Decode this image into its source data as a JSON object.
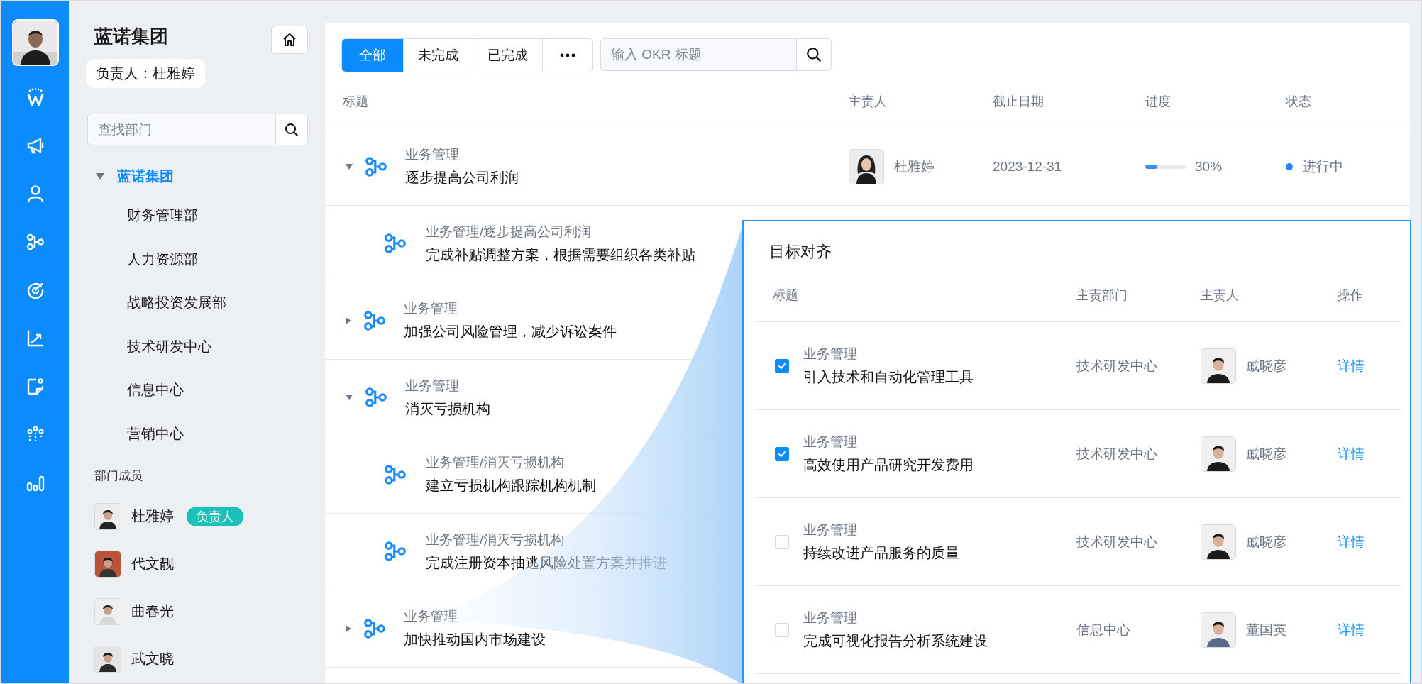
{
  "org": {
    "title": "蓝诺集团",
    "owner": "负责人：杜雅婷",
    "search": {
      "placeholder": "查找部门"
    },
    "tree": [
      {
        "label": "蓝诺集团",
        "selected": true,
        "expanded": true,
        "children": [
          {
            "label": "财务管理部",
            "selected": false
          },
          {
            "label": "人力资源部",
            "selected": false
          },
          {
            "label": "战略投资发展部",
            "selected": false
          },
          {
            "label": "技术研发中心",
            "selected": false
          },
          {
            "label": "信息中心",
            "selected": false
          },
          {
            "label": "营销中心",
            "selected": false
          }
        ]
      }
    ],
    "members_title": "部门成员",
    "members": [
      {
        "name": "杜雅婷",
        "badge": "负责人"
      },
      {
        "name": "代文靓"
      },
      {
        "name": "曲春光"
      },
      {
        "name": "武文晓"
      }
    ]
  },
  "filters": [
    {
      "label": "全部",
      "selected": true
    },
    {
      "label": "未完成",
      "selected": false
    },
    {
      "label": "已完成",
      "selected": false
    }
  ],
  "okr_search": {
    "placeholder": "输入 OKR 标题"
  },
  "table": {
    "columns": [
      "标题",
      "主责人",
      "截止日期",
      "进度",
      "状态"
    ],
    "rows": [
      {
        "category": "业务管理",
        "title": "逐步提高公司利润",
        "expanded": true,
        "owner": "杜雅婷",
        "due": "2023-12-31",
        "level": 0.3,
        "progress": "30%",
        "status": "进行中",
        "color": "#1a8cff",
        "children": [
          {
            "category": "业务管理/逐步提高公司利润",
            "title": "完成补贴调整方案，根据需要组织各类补贴"
          }
        ]
      },
      {
        "category": "业务管理",
        "title": "加强公司风险管理，减少诉讼案件",
        "expanded": false
      },
      {
        "category": "业务管理",
        "title": "消灭亏损机构",
        "expanded": true,
        "children": [
          {
            "category": "业务管理/消灭亏损机构",
            "title": "建立亏损机构跟踪机构机制"
          },
          {
            "category": "业务管理/消灭亏损机构",
            "title": "完成注册资本抽逃风险处置方案并推进"
          }
        ]
      },
      {
        "category": "业务管理",
        "title": "加快推动国内市场建设",
        "expanded": false
      }
    ]
  },
  "alignment": {
    "title": "目标对齐",
    "columns": [
      "标题",
      "主责部门",
      "主责人",
      "操作"
    ],
    "rows": [
      {
        "checked": true,
        "category": "业务管理",
        "title": "引入技术和自动化管理工具",
        "department": "技术研发中心",
        "owner": "戚晓彦",
        "action": "详情"
      },
      {
        "checked": true,
        "category": "业务管理",
        "title": "高效使用产品研究开发费用",
        "department": "技术研发中心",
        "owner": "戚晓彦",
        "action": "详情"
      },
      {
        "checked": false,
        "category": "业务管理",
        "title": "持续改进产品服务的质量",
        "department": "技术研发中心",
        "owner": "戚晓彦",
        "action": "详情"
      },
      {
        "checked": false,
        "category": "业务管理",
        "title": "完成可视化报告分析系统建设",
        "department": "信息中心",
        "owner": "董国英",
        "action": "详情"
      }
    ]
  }
}
